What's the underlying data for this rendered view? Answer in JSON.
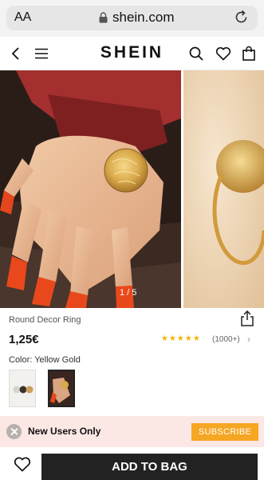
{
  "browser": {
    "text_size_label": "AA",
    "domain": "shein.com"
  },
  "header": {
    "brand": "SHEIN"
  },
  "gallery": {
    "pager": "1 / 5"
  },
  "product": {
    "name": "Round Decor Ring",
    "price": "1,25€",
    "rating_stars": "★★★★★",
    "rating": 5,
    "review_count": "(1000+)",
    "review_chevron": "›",
    "color_label": "Color: Yellow Gold"
  },
  "banner": {
    "text": "New Users Only",
    "subscribe": "SUBSCRIBE"
  },
  "bottom": {
    "add_to_bag": "ADD TO BAG"
  },
  "colors": {
    "accent_orange": "#f5a623",
    "banner_bg": "#fbe8e4",
    "add_to_bag_bg": "#222222"
  }
}
